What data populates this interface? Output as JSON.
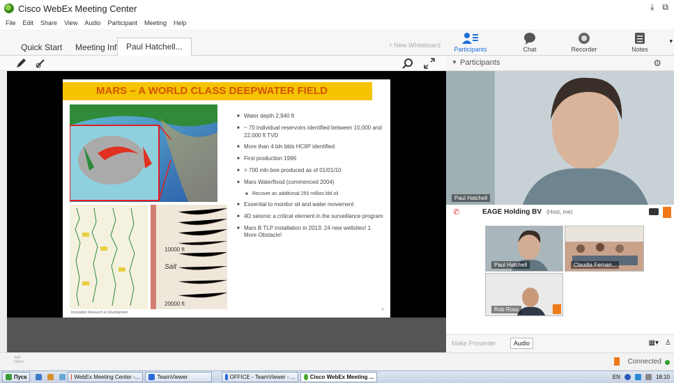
{
  "window": {
    "title": "Cisco WebEx Meeting Center",
    "controls": [
      "⤓",
      "⧉"
    ]
  },
  "menu": [
    "File",
    "Edit",
    "Share",
    "View",
    "Audio",
    "Participant",
    "Meeting",
    "Help"
  ],
  "tabs": [
    "Quick Start",
    "Meeting Info",
    "Paul Hatchell..."
  ],
  "new_whiteboard": "+ New Whiteboard",
  "panel_tools": [
    "Participants",
    "Chat",
    "Recorder",
    "Notes"
  ],
  "participants_header": "Participants",
  "slide": {
    "title": "MARS – A WORLD CLASS DEEPWATER FIELD",
    "bullets": [
      "Water depth 2,940 ft",
      "~ 70 individual reservoirs identified between 10,000 and 22,000 ft TVD",
      "More than 4 bln bbls HCIIP identified",
      "First production 1996",
      "> 700 mln boe produced as of 01/01/10",
      "Mars Waterflood (commenced 2004)",
      "Recover an additional 250 million bbl oil",
      "Essential to monitor oil and water movement",
      "4D seismic a critical element in the surveillance program",
      "Mars B TLP installation in 2013: 24 new wellsites! 1 More Obstacle!"
    ],
    "seismic_labels": {
      "salt": "Salt",
      "depth1": "10000 ft",
      "depth2": "20000 ft"
    },
    "footer": "Innovation Research & Development",
    "page": "4"
  },
  "video": {
    "main_name": "Paul Hatchell"
  },
  "host": {
    "name": "EAGE Holding BV",
    "role": "(Host, me)"
  },
  "thumbs": [
    "Paul Hatchell",
    "Claudia Fernan...",
    "Rob Ross"
  ],
  "panel_bottom": {
    "make_presenter": "Make Presenter",
    "audio": "Audio"
  },
  "status": {
    "cisco": "cisco",
    "connected": "Connected"
  },
  "taskbar": {
    "start": "Пуск",
    "items": [
      "WebEx Meeting Center -...",
      "TeamViewer",
      "OFFICE - TeamViewer - ...",
      "Cisco WebEx Meeting ..."
    ],
    "lang": "EN",
    "clock": "18:10"
  }
}
